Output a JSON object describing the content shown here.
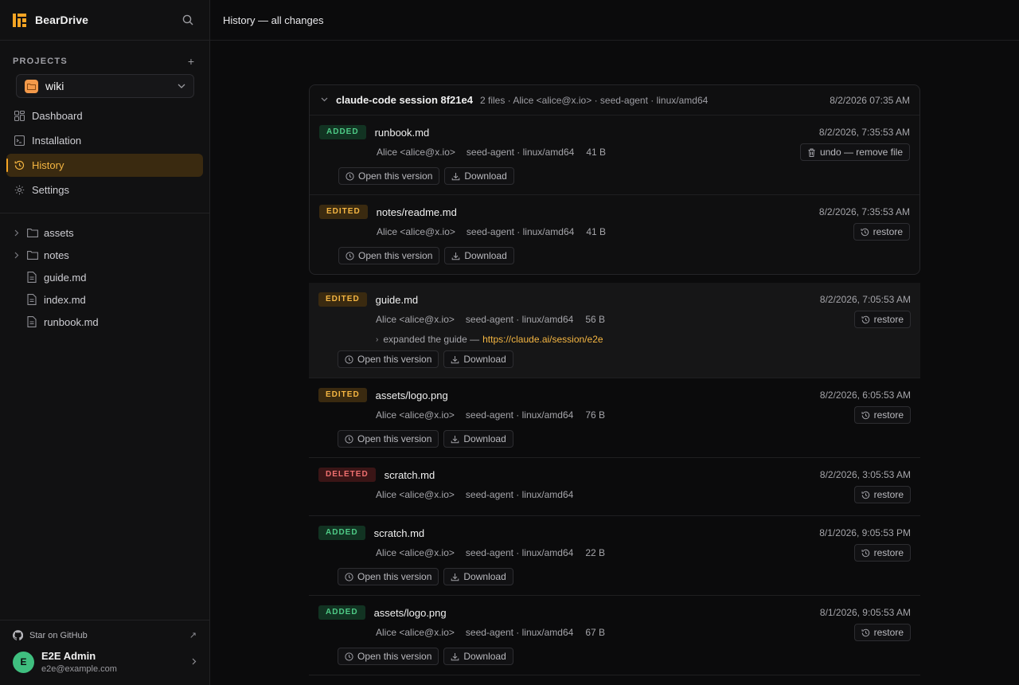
{
  "app": {
    "name": "BearDrive"
  },
  "colors": {
    "accent": "#f5a524",
    "added": "#4ecb86",
    "edited": "#f5b642",
    "deleted": "#f07070",
    "avatar": "#3fbf7f"
  },
  "sidebar": {
    "projects_label": "PROJECTS",
    "add_icon": "plus-icon",
    "project": {
      "name": "wiki"
    },
    "nav": [
      {
        "label": "Dashboard",
        "icon": "dashboard-icon"
      },
      {
        "label": "Installation",
        "icon": "terminal-icon"
      },
      {
        "label": "History",
        "icon": "history-icon",
        "active": true
      },
      {
        "label": "Settings",
        "icon": "gear-icon"
      }
    ],
    "tree": [
      {
        "type": "folder",
        "name": "assets"
      },
      {
        "type": "folder",
        "name": "notes"
      },
      {
        "type": "file",
        "name": "guide.md"
      },
      {
        "type": "file",
        "name": "index.md"
      },
      {
        "type": "file",
        "name": "runbook.md"
      }
    ],
    "github_label": "Star on GitHub",
    "user": {
      "initial": "E",
      "name": "E2E Admin",
      "email": "e2e@example.com"
    }
  },
  "topbar": {
    "title": "History — all changes"
  },
  "session": {
    "title": "claude-code session 8f21e4",
    "meta": "2 files · Alice <alice@x.io> · seed-agent · linux/amd64",
    "time": "8/2/2026 07:35 AM"
  },
  "actions": {
    "open": "Open this version",
    "download": "Download",
    "restore": "restore",
    "undo": "undo — remove file"
  },
  "entries": [
    {
      "badge": "ADDED",
      "file": "runbook.md",
      "time": "8/2/2026, 7:35:53 AM",
      "author": "Alice <alice@x.io>",
      "agent": "seed-agent · linux/amd64",
      "size": "41 B"
    },
    {
      "badge": "EDITED",
      "file": "notes/readme.md",
      "time": "8/2/2026, 7:35:53 AM",
      "author": "Alice <alice@x.io>",
      "agent": "seed-agent · linux/amd64",
      "size": "41 B"
    },
    {
      "badge": "EDITED",
      "file": "guide.md",
      "time": "8/2/2026, 7:05:53 AM",
      "author": "Alice <alice@x.io>",
      "agent": "seed-agent · linux/amd64",
      "size": "56 B",
      "note": "expanded the guide —",
      "link": "https://claude.ai/session/e2e"
    },
    {
      "badge": "EDITED",
      "file": "assets/logo.png",
      "time": "8/2/2026, 6:05:53 AM",
      "author": "Alice <alice@x.io>",
      "agent": "seed-agent · linux/amd64",
      "size": "76 B"
    },
    {
      "badge": "DELETED",
      "file": "scratch.md",
      "time": "8/2/2026, 3:05:53 AM",
      "author": "Alice <alice@x.io>",
      "agent": "seed-agent · linux/amd64"
    },
    {
      "badge": "ADDED",
      "file": "scratch.md",
      "time": "8/1/2026, 9:05:53 PM",
      "author": "Alice <alice@x.io>",
      "agent": "seed-agent · linux/amd64",
      "size": "22 B"
    },
    {
      "badge": "ADDED",
      "file": "assets/logo.png",
      "time": "8/1/2026, 9:05:53 AM",
      "author": "Alice <alice@x.io>",
      "agent": "seed-agent · linux/amd64",
      "size": "67 B"
    }
  ]
}
